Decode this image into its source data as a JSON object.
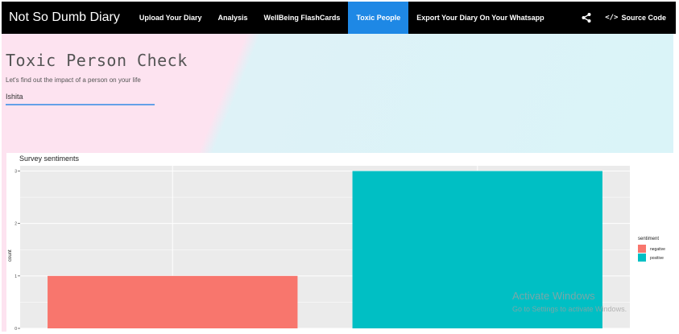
{
  "navbar": {
    "brand": "Not So Dumb Diary",
    "items": [
      {
        "label": "Upload Your Diary",
        "active": false
      },
      {
        "label": "Analysis",
        "active": false
      },
      {
        "label": "WellBeing FlashCards",
        "active": false
      },
      {
        "label": "Toxic People",
        "active": true
      },
      {
        "label": "Export Your Diary On Your Whatsapp",
        "active": false
      }
    ],
    "share_icon": "share-icon",
    "source_code_label": "Source Code",
    "source_code_icon": "</>",
    "active_color": "#1e88e5"
  },
  "page": {
    "title": "Toxic Person Check",
    "subtitle": "Let's find out the impact of a person on your life",
    "name_input_value": "Ishita"
  },
  "chart_data": {
    "type": "bar",
    "title": "Survey sentiments",
    "xlabel": "",
    "ylabel": "count",
    "categories": [
      "negative",
      "positive"
    ],
    "values": [
      1,
      3
    ],
    "colors": [
      "#f8766d",
      "#00bfc4"
    ],
    "ylim": [
      0,
      3.1
    ],
    "yticks": [
      0,
      1,
      2,
      3
    ],
    "grid": true,
    "legend": {
      "title": "sentiment",
      "entries": [
        "negative",
        "positive"
      ],
      "placement": "right"
    }
  },
  "watermark": {
    "line1": "Activate Windows",
    "line2": "Go to Settings to activate Windows."
  }
}
